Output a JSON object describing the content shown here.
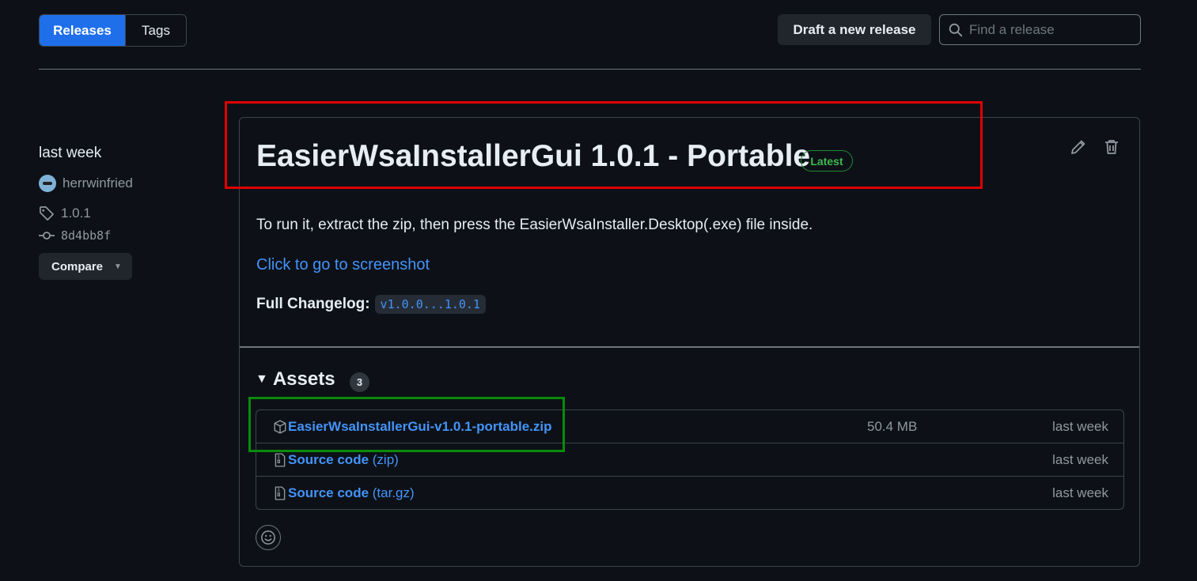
{
  "tabs": [
    {
      "label": "Releases",
      "active": true
    },
    {
      "label": "Tags",
      "active": false
    }
  ],
  "toolbar": {
    "draft_label": "Draft a new release",
    "search_placeholder": "Find a release"
  },
  "meta": {
    "date": "last week",
    "author": "herrwinfried",
    "tag": "1.0.1",
    "commit": "8d4bb8f",
    "compare_label": "Compare"
  },
  "release": {
    "title": "EasierWsaInstallerGui 1.0.1 - Portable",
    "badge": "Latest",
    "body": "To run it, extract the zip, then press the EasierWsaInstaller.Desktop(.exe) file inside.",
    "link_text": "Click to go to screenshot",
    "changelog_label": "Full Changelog:",
    "changelog_code": "v1.0.0...1.0.1"
  },
  "assets": {
    "title": "Assets",
    "count": "3",
    "items": [
      {
        "name": "EasierWsaInstallerGui-v1.0.1-portable.zip",
        "suffix": "",
        "size": "50.4 MB",
        "date": "last week",
        "icon": "package-icon"
      },
      {
        "name": "Source code",
        "suffix": " (zip)",
        "size": "",
        "date": "last week",
        "icon": "file-zip-icon"
      },
      {
        "name": "Source code",
        "suffix": " (tar.gz)",
        "size": "",
        "date": "last week",
        "icon": "file-zip-icon"
      }
    ]
  },
  "colors": {
    "accent": "#1f6feb",
    "link": "#4493f8",
    "latest": "#3fb950",
    "annotation_red": "#e00000",
    "annotation_green": "#0a8a0a"
  }
}
